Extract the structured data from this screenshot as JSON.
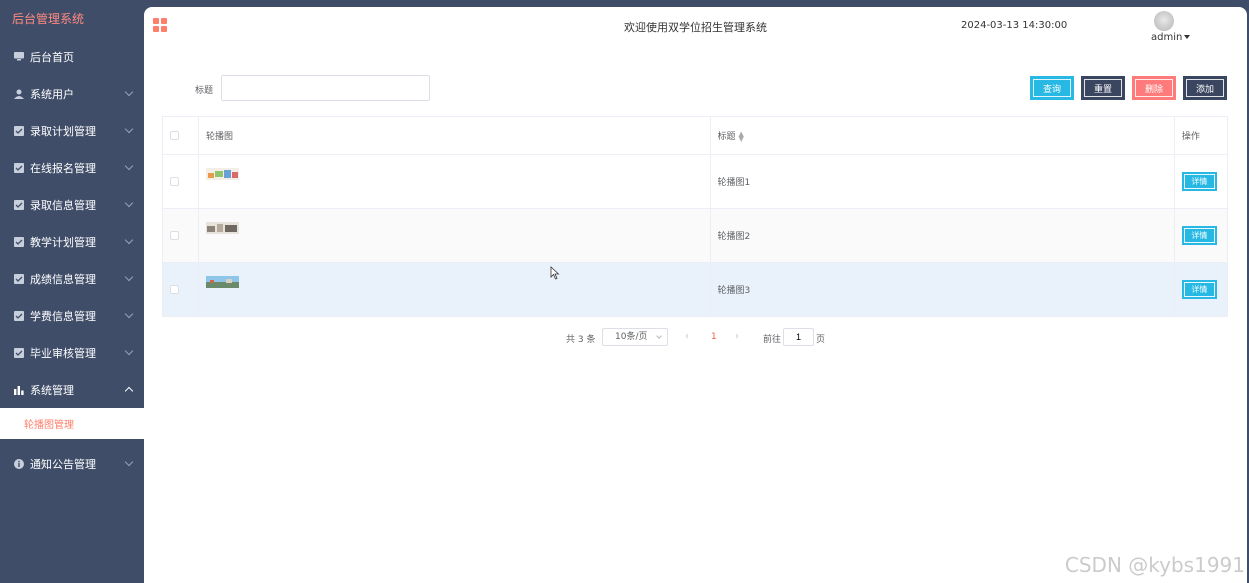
{
  "sidebar": {
    "brand": "后台管理系统",
    "items": [
      {
        "label": "后台首页",
        "icon": "monitor-icon",
        "has_chevron": false
      },
      {
        "label": "系统用户",
        "icon": "user-icon",
        "has_chevron": true
      },
      {
        "label": "录取计划管理",
        "icon": "checkbox-icon",
        "has_chevron": true
      },
      {
        "label": "在线报名管理",
        "icon": "checkbox-icon",
        "has_chevron": true
      },
      {
        "label": "录取信息管理",
        "icon": "checkbox-icon",
        "has_chevron": true
      },
      {
        "label": "教学计划管理",
        "icon": "checkbox-icon",
        "has_chevron": true
      },
      {
        "label": "成绩信息管理",
        "icon": "checkbox-icon",
        "has_chevron": true
      },
      {
        "label": "学费信息管理",
        "icon": "checkbox-icon",
        "has_chevron": true
      },
      {
        "label": "毕业审核管理",
        "icon": "checkbox-icon",
        "has_chevron": true
      },
      {
        "label": "系统管理",
        "icon": "bar-chart-icon",
        "has_chevron": true,
        "open": true
      }
    ],
    "submenu_active": "轮播图管理",
    "last_item": {
      "label": "通知公告管理",
      "icon": "info-icon"
    }
  },
  "header": {
    "welcome": "欢迎使用双学位招生管理系统",
    "datetime": "2024-03-13 14:30:00",
    "username": "admin"
  },
  "search": {
    "label": "标题",
    "value": "",
    "placeholder": ""
  },
  "toolbar": {
    "query": "查询",
    "reset": "重置",
    "delete": "删除",
    "add": "添加"
  },
  "table": {
    "headers": {
      "image": "轮播图",
      "title": "标题",
      "actions": "操作"
    },
    "rows": [
      {
        "title": "轮播图1",
        "detail": "详情"
      },
      {
        "title": "轮播图2",
        "detail": "详情"
      },
      {
        "title": "轮播图3",
        "detail": "详情"
      }
    ]
  },
  "pagination": {
    "total": "共 3 条",
    "page_size": "10条/页",
    "current_page": "1",
    "goto_label": "前往",
    "goto_value": "1",
    "page_unit": "页"
  },
  "watermark": "CSDN @kybs1991",
  "colors": {
    "sidebar_bg": "#3f4d69",
    "accent": "#ff7f6b",
    "primary_button": "#27b9e4",
    "dark_button": "#3a4560",
    "danger_button": "#ff7a7a"
  }
}
